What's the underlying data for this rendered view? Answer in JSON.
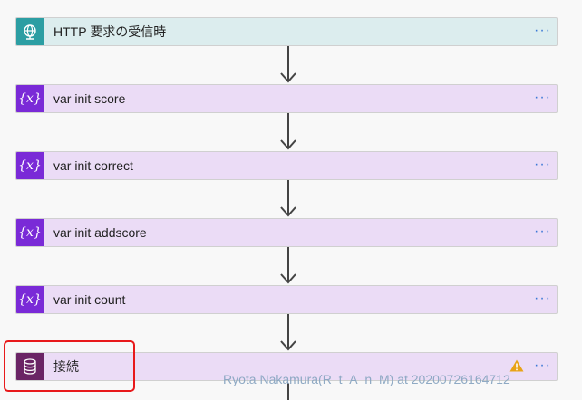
{
  "steps": [
    {
      "label": "HTTP 要求の受信時"
    },
    {
      "label": "var init score"
    },
    {
      "label": "var init correct"
    },
    {
      "label": "var init addscore"
    },
    {
      "label": "var init count"
    },
    {
      "label": "接続"
    }
  ],
  "more_label": "···",
  "var_icon_text": "{x}",
  "watermark": "Ryota Nakamura(R_t_A_n_M) at 20200726164712",
  "colors": {
    "http_accent": "#2c9ea3",
    "variable_accent": "#7a2ad7",
    "connection_accent": "#6a2465",
    "highlight_border": "#e8191b",
    "warning": "#e8a317"
  },
  "icons": {
    "http": "globe-icon",
    "variable": "variable-icon",
    "connection": "database-icon",
    "warning": "warning-icon",
    "more": "more-options-icon"
  }
}
